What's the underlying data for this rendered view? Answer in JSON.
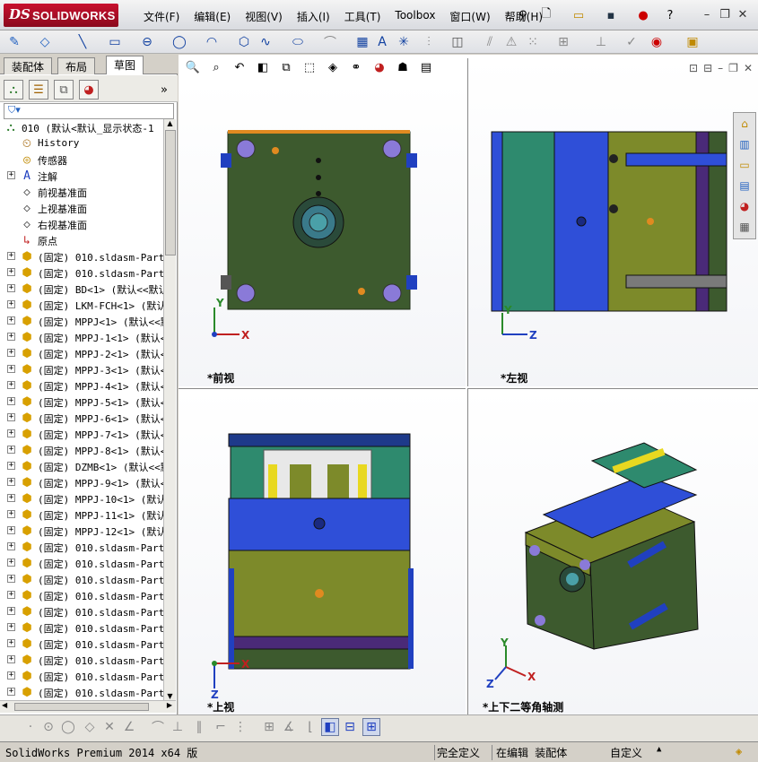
{
  "app": {
    "brand_ds": "DS",
    "brand_name": "SOLIDWORKS"
  },
  "menu": [
    "文件(F)",
    "编辑(E)",
    "视图(V)",
    "插入(I)",
    "工具(T)",
    "Toolbox",
    "窗口(W)",
    "帮助(H)"
  ],
  "tabs": [
    "装配体",
    "布局",
    "草图"
  ],
  "active_tab": "草图",
  "filter_icon": "funnel-icon",
  "tree": {
    "root": "010  (默认<默认_显示状态-1",
    "items": [
      {
        "label": "History",
        "icon": "history-icon"
      },
      {
        "label": "传感器",
        "icon": "sensor-icon"
      },
      {
        "label": "注解",
        "icon": "annotation-icon",
        "expandable": true
      },
      {
        "label": "前视基准面",
        "icon": "plane-icon"
      },
      {
        "label": "上视基准面",
        "icon": "plane-icon"
      },
      {
        "label": "右视基准面",
        "icon": "plane-icon"
      },
      {
        "label": "原点",
        "icon": "origin-icon"
      },
      {
        "label": "(固定) 010.sldasm-Part-",
        "icon": "part-icon",
        "expandable": true
      },
      {
        "label": "(固定) 010.sldasm-Part-",
        "icon": "part-icon",
        "expandable": true
      },
      {
        "label": "(固定) BD<1> (默认<<默认",
        "icon": "part-icon",
        "expandable": true
      },
      {
        "label": "(固定) LKM-FCH<1> (默认",
        "icon": "part-icon",
        "expandable": true
      },
      {
        "label": "(固定) MPPJ<1> (默认<<默",
        "icon": "part-icon",
        "expandable": true
      },
      {
        "label": "(固定) MPPJ-1<1> (默认<",
        "icon": "part-icon",
        "expandable": true
      },
      {
        "label": "(固定) MPPJ-2<1> (默认<",
        "icon": "part-icon",
        "expandable": true
      },
      {
        "label": "(固定) MPPJ-3<1> (默认<",
        "icon": "part-icon",
        "expandable": true
      },
      {
        "label": "(固定) MPPJ-4<1> (默认<",
        "icon": "part-icon",
        "expandable": true
      },
      {
        "label": "(固定) MPPJ-5<1> (默认<",
        "icon": "part-icon",
        "expandable": true
      },
      {
        "label": "(固定) MPPJ-6<1> (默认<",
        "icon": "part-icon",
        "expandable": true
      },
      {
        "label": "(固定) MPPJ-7<1> (默认<",
        "icon": "part-icon",
        "expandable": true
      },
      {
        "label": "(固定) MPPJ-8<1> (默认<",
        "icon": "part-icon",
        "expandable": true
      },
      {
        "label": "(固定) DZMB<1> (默认<<默",
        "icon": "part-icon",
        "expandable": true
      },
      {
        "label": "(固定) MPPJ-9<1> (默认<",
        "icon": "part-icon",
        "expandable": true
      },
      {
        "label": "(固定) MPPJ-10<1> (默认",
        "icon": "part-icon",
        "expandable": true
      },
      {
        "label": "(固定) MPPJ-11<1> (默认",
        "icon": "part-icon",
        "expandable": true
      },
      {
        "label": "(固定) MPPJ-12<1> (默认<",
        "icon": "part-icon",
        "expandable": true
      },
      {
        "label": "(固定) 010.sldasm-Part-",
        "icon": "part-icon",
        "expandable": true
      },
      {
        "label": "(固定) 010.sldasm-Part-",
        "icon": "part-icon",
        "expandable": true
      },
      {
        "label": "(固定) 010.sldasm-Part-",
        "icon": "part-icon",
        "expandable": true
      },
      {
        "label": "(固定) 010.sldasm-Part-",
        "icon": "part-icon",
        "expandable": true
      },
      {
        "label": "(固定) 010.sldasm-Part-",
        "icon": "part-icon",
        "expandable": true
      },
      {
        "label": "(固定) 010.sldasm-Part-",
        "icon": "part-icon",
        "expandable": true
      },
      {
        "label": "(固定) 010.sldasm-Part-",
        "icon": "part-icon",
        "expandable": true
      },
      {
        "label": "(固定) 010.sldasm-Part-",
        "icon": "part-icon",
        "expandable": true
      },
      {
        "label": "(固定) 010.sldasm-Part-",
        "icon": "part-icon",
        "expandable": true
      },
      {
        "label": "(固定) 010.sldasm-Part-",
        "icon": "part-icon",
        "expandable": true
      }
    ]
  },
  "views": {
    "front": "*前视",
    "left": "*左视",
    "top": "*上视",
    "iso": "*上下二等角轴测"
  },
  "axes": {
    "x": "X",
    "y": "Y",
    "z": "Z"
  },
  "status": {
    "version": "SolidWorks Premium 2014 x64 版",
    "defined": "完全定义",
    "editing": "在编辑 装配体",
    "custom": "自定义"
  },
  "colors": {
    "mold_green": "#3d5a2e",
    "plate_blue": "#2f4fd8",
    "plate_olive": "#7d8a2a",
    "plate_teal": "#2e8a6e",
    "purple": "#4a2a78"
  }
}
